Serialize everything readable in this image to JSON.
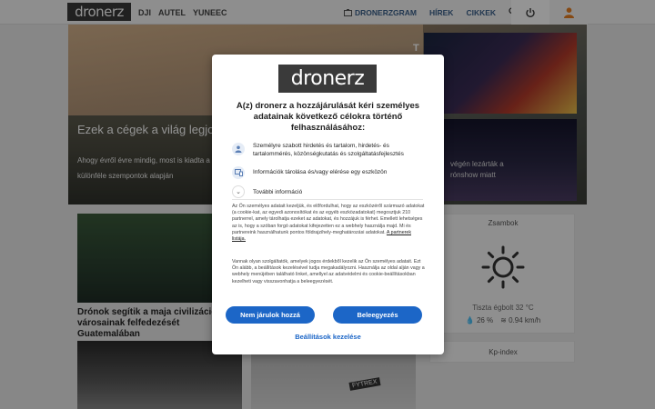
{
  "nav": {
    "logo": "dronerz",
    "brands": [
      "DJI",
      "AUTEL",
      "YUNEEC"
    ],
    "dronerzgram": "DRONERZGRAM",
    "hirek": "HÍREK",
    "cikkek": "CIKKEK",
    "icons": {
      "search": "search-icon",
      "camera": "camera-icon",
      "power": "power-icon",
      "user": "user-icon"
    }
  },
  "hero": {
    "title": "Ezek a cégek a világ legjobb",
    "description": "Ahogy évről évre mindig, most is kiadta a amelyben különféle szempontok alapján",
    "side_caption_line1": "végén lezárták a",
    "side_caption_line2": "rónshow miatt",
    "t_letter": "T"
  },
  "articles": {
    "first_caption": "Drónok segítik a maja civilizáció elve városainak felfedezését Guatemalában",
    "third_tag": "FYTREX"
  },
  "weather": {
    "title": "Zsambok",
    "condition": "Tiszta égbolt 32 °C",
    "humidity": "26 %",
    "wind": "0.94 km/h"
  },
  "kp": {
    "title": "Kp-index"
  },
  "dialog": {
    "logo": "dronerz",
    "heading": "A(z) dronerz a hozzájárulását kéri személyes adatainak következő célokra történő felhasználásához:",
    "purpose_1": "Személyre szabott hirdetés és tartalom, hirdetés- és tartalommérés, közönségkutatás és szolgáltatásfejlesztés",
    "purpose_2": "Információk tárolása és/vagy elérése egy eszközön",
    "more_info": "További információ",
    "body_1": "Az Ön személyes adatait kezeljük, és előfordulhat, hogy az eszközéről származó adatokat (a cookie-kat, az egyedi azonosítókat és az egyéb eszközadatokat) megosztjuk 210 partnerrel, amely tárolhatja ezeket az adatokat, és hozzájuk is férhet. Emellett lehetséges az is, hogy a szóban forgó adatokat kifejezetten ez a webhely használja majd. Mi és partnereink használhatunk pontos földrajzihely-meghatározási adatokat.",
    "partner_link": "A partnerek listája.",
    "body_2": "Vannak olyan szolgáltatók, amelyek jogos érdekből kezelik az Ön személyes adatait. Ezt Ön alább, a beállítások kezelésével tudja megakadályozni. Használja az oldal alján vagy a webhely menüjében található linket, amellyel az adatvédelmi és cookie-beállításokban kezelheti vagy visszavonhatja a beleegyezését.",
    "decline": "Nem járulok hozzá",
    "accept": "Beleegyezés",
    "manage": "Beállítások kezelése"
  },
  "colors": {
    "accent": "#1c66c7",
    "nav_link": "#3a5f8a",
    "user_icon": "#e67e22"
  }
}
